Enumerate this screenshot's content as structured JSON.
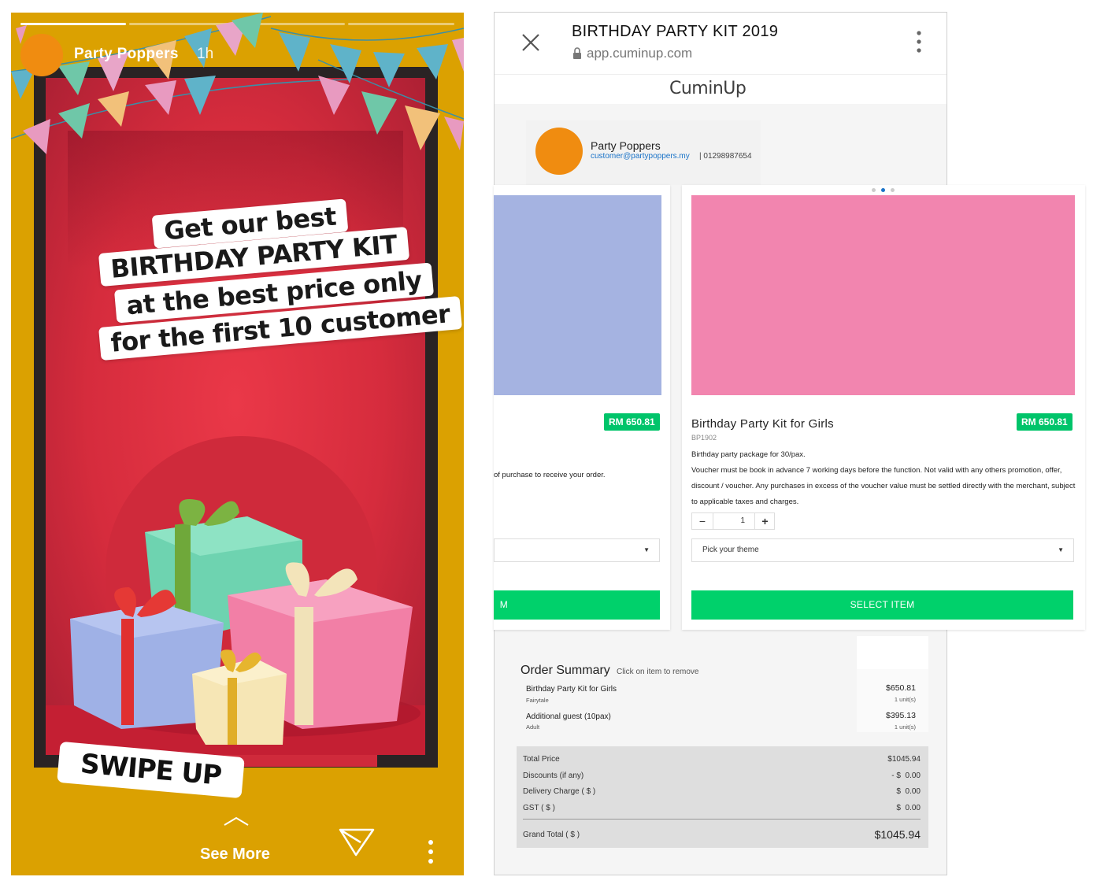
{
  "story": {
    "account_name": "Party Poppers",
    "time_ago": "1h",
    "headline_lines": [
      "Get our best",
      "BIRTHDAY PARTY KIT",
      "at the best price only",
      "for the first 10 customer"
    ],
    "swipe_label": "SWIPE UP",
    "see_more_label": "See More",
    "colors": {
      "background": "#dba101",
      "avatar": "#f08c10",
      "wall": "#e2323f"
    }
  },
  "browser": {
    "title": "BIRTHDAY PARTY KIT 2019",
    "url": "app.cuminup.com",
    "logo": "CuminUp",
    "merchant": {
      "name": "Party Poppers",
      "email": "customer@partypoppers.my",
      "phone": "| 01298987654"
    },
    "left_card": {
      "price": "RM 650.81",
      "description_fragment": "of purchase to receive your order.",
      "button_fragment": "M"
    },
    "item": {
      "name": "Birthday Party Kit for Girls",
      "sku": "BP1902",
      "price": "RM 650.81",
      "description_line1": "Birthday party package for 30/pax.",
      "description_line2": "Voucher must be book in advance 7 working days before the function. Not valid with any others promotion, offer, discount / voucher. Any purchases in excess of the voucher value must be settled directly with the merchant, subject to applicable taxes and charges.",
      "quantity": "1",
      "minus_label": "−",
      "plus_label": "+",
      "theme_placeholder": "Pick your theme",
      "select_label": "SELECT ITEM"
    },
    "order_summary": {
      "title": "Order Summary",
      "hint": "Click on item to remove",
      "items": [
        {
          "name": "Birthday Party Kit for Girls",
          "sub": "Fairytale",
          "amount": "$650.81",
          "units": "1 unit(s)"
        },
        {
          "name": "Additional guest (10pax)",
          "sub": "Adult",
          "amount": "$395.13",
          "units": "1 unit(s)"
        }
      ],
      "totals": [
        {
          "label": "Total Price",
          "value": "$1045.94"
        },
        {
          "label": "Discounts (if any)",
          "value": "- $  0.00"
        },
        {
          "label": "Delivery Charge ( $ )",
          "value": "$  0.00"
        },
        {
          "label": "GST ( $ )",
          "value": "$  0.00"
        }
      ],
      "grand_total_label": "Grand Total ( $ )",
      "grand_total_value": "$1045.94"
    },
    "colors": {
      "accent_green": "#00d16b",
      "price_green": "#00c46a",
      "left_image": "#a5b3e1",
      "right_image": "#f285af"
    }
  }
}
